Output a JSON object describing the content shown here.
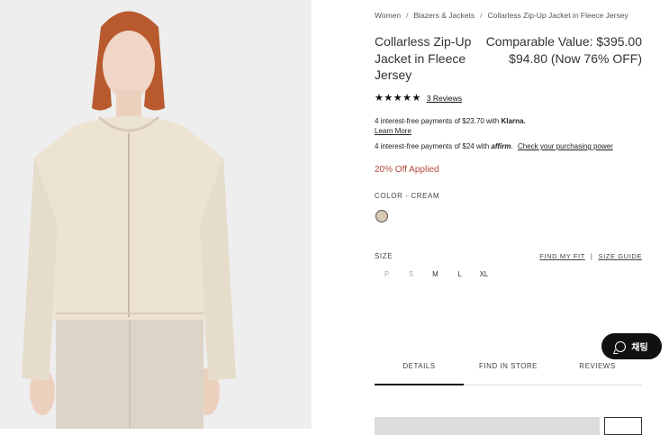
{
  "breadcrumb": [
    "Women",
    "Blazers & Jackets",
    "Collarless Zip-Up Jacket in Fleece Jersey"
  ],
  "product": {
    "title": "Collarless Zip-Up Jacket in Fleece Jersey",
    "comparable_value": "Comparable Value: $395.00",
    "price_now": "$94.80 (Now 76% OFF)"
  },
  "rating": {
    "stars": "★★★★★",
    "reviews": "3 Reviews"
  },
  "klarna": {
    "text": "4 interest-free payments of $23.70 with",
    "brand": "Klarna.",
    "learn_more": "Learn More"
  },
  "affirm": {
    "text": "4 interest-free payments of $24 with",
    "brand": "affirm",
    "link": "Check your purchasing power"
  },
  "promo": "20% Off Applied",
  "color": {
    "label": "COLOR -  CREAM",
    "swatch": "#d8c9b3"
  },
  "size": {
    "label": "SIZE",
    "find_fit": "FIND MY FIT",
    "guide": "SIZE GUIDE",
    "options": [
      "P",
      "S",
      "M",
      "L",
      "XL"
    ]
  },
  "tabs": [
    "DETAILS",
    "FIND IN STORE",
    "REVIEWS"
  ],
  "chat": {
    "label": "채팅",
    "icon": "chat-bubble-icon"
  },
  "colors": {
    "promo": "#b5473a",
    "photo_bg": "#eeeeef",
    "jacket": "#ece3d3"
  }
}
